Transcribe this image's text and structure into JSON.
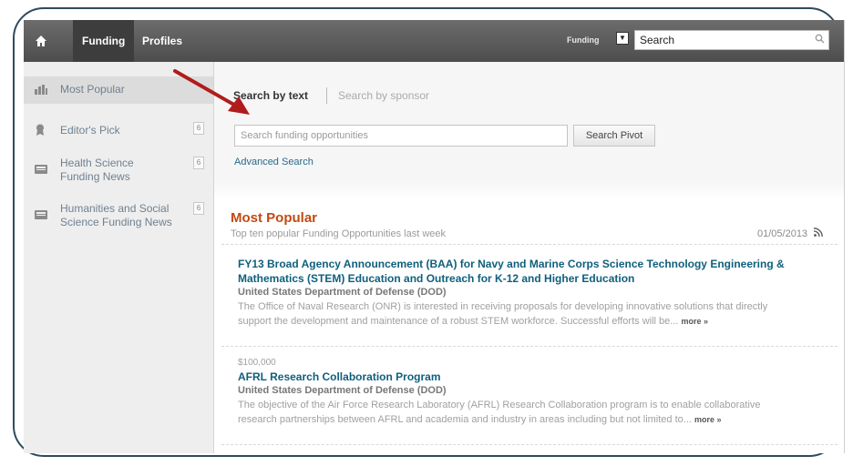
{
  "topnav": {
    "tabs": [
      {
        "label": "Funding"
      },
      {
        "label": "Profiles"
      }
    ],
    "search_scope": "Funding",
    "search_placeholder": "Search"
  },
  "sidebar": {
    "items": [
      {
        "label": "Most Popular",
        "badge": ""
      },
      {
        "label": "Editor's Pick",
        "badge": "6"
      },
      {
        "label_line1": "Health Science",
        "label_line2": "Funding News",
        "badge": "6"
      },
      {
        "label_line1": "Humanities and Social",
        "label_line2": "Science Funding News",
        "badge": "6"
      }
    ]
  },
  "search": {
    "tab_text": "Search by text",
    "tab_sponsor": "Search by sponsor",
    "input_placeholder": "Search funding opportunities",
    "button_label": "Search Pivot",
    "advanced_link": "Advanced Search"
  },
  "results": {
    "title": "Most Popular",
    "subtitle": "Top ten popular Funding Opportunities last week",
    "date": "01/05/2013",
    "items": [
      {
        "amount": "",
        "title_line1": "FY13 Broad Agency Announcement (BAA) for Navy and Marine Corps Science Technology Engineering &",
        "title_line2": "Mathematics (STEM) Education and Outreach for K-12 and Higher Education",
        "org": "United States Department of Defense (DOD)",
        "desc_line1": "The Office of Naval Research (ONR) is interested in receiving proposals for developing innovative solutions that directly",
        "desc_line2": "support the development and maintenance of a robust STEM workforce. Successful efforts will be...",
        "more": "more »"
      },
      {
        "amount": "$100,000",
        "title_line1": "AFRL Research Collaboration Program",
        "org": "United States Department of Defense (DOD)",
        "desc_line1": "The objective of the Air Force Research Laboratory (AFRL) Research Collaboration program is to enable collaborative",
        "desc_line2": "research partnerships between AFRL and academia and industry in areas including but not limited to...",
        "more": "more »"
      }
    ]
  },
  "colors": {
    "topbar": "#555555",
    "accent_orange": "#c04a12",
    "link_teal": "#0f5f7c",
    "annotation_arrow": "#b01c1c"
  }
}
